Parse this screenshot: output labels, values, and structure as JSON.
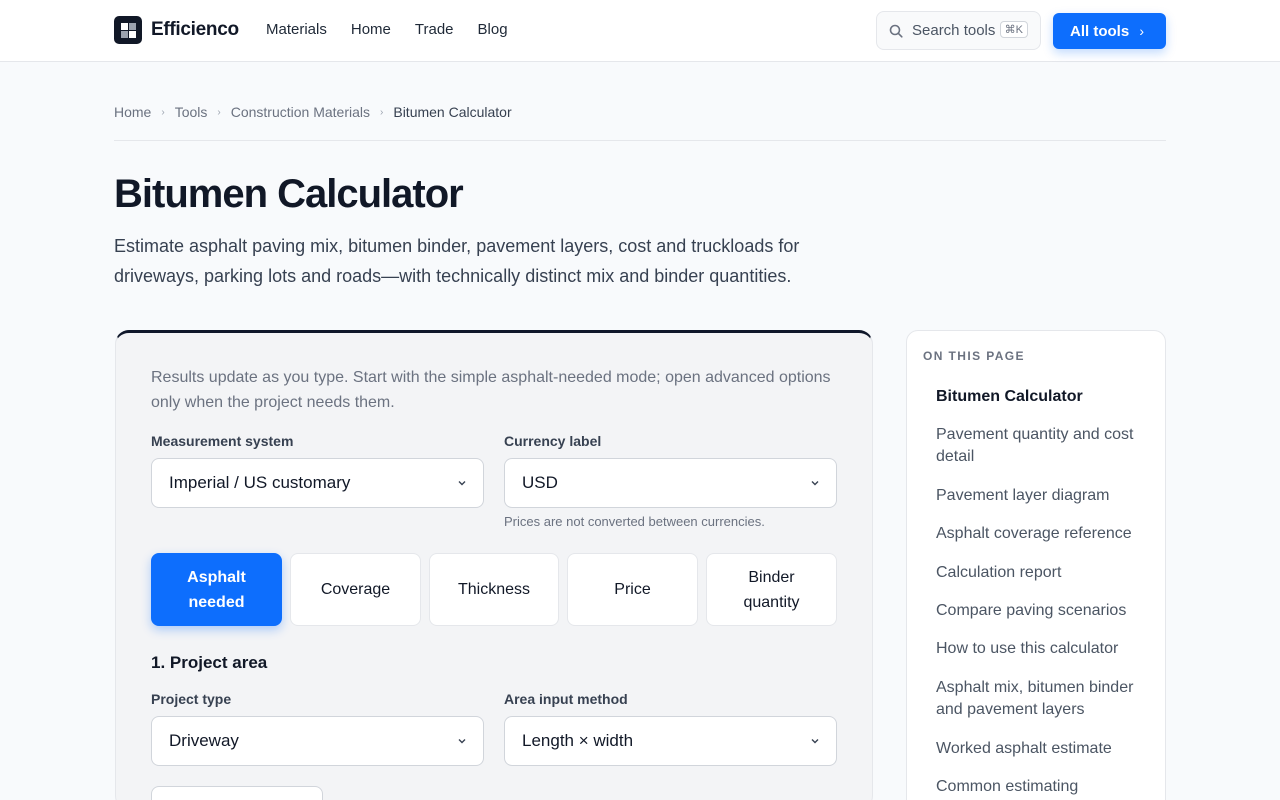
{
  "header": {
    "brand": "Efficienco",
    "nav": [
      "Materials",
      "Home",
      "Trade",
      "Blog"
    ],
    "search_label": "Search tools",
    "search_shortcut": "⌘K",
    "all_tools_label": "All tools",
    "accent": "#0d6efd"
  },
  "breadcrumb": [
    "Home",
    "Tools",
    "Construction Materials",
    "Bitumen Calculator"
  ],
  "page": {
    "title": "Bitumen Calculator",
    "lead": "Estimate asphalt paving mix, bitumen binder, pavement layers, cost and truckloads for driveways, parking lots and roads—with technically distinct mix and binder quantities."
  },
  "calculator": {
    "intro": "Results update as you type. Start with the simple asphalt-needed mode; open advanced options only when the project needs them.",
    "measurement": {
      "label": "Measurement system",
      "value": "Imperial / US customary"
    },
    "currency": {
      "label": "Currency label",
      "value": "USD",
      "help": "Prices are not converted between currencies."
    },
    "modes": [
      {
        "label": "Asphalt needed",
        "active": true
      },
      {
        "label": "Coverage",
        "active": false
      },
      {
        "label": "Thickness",
        "active": false
      },
      {
        "label": "Price",
        "active": false
      },
      {
        "label": "Binder quantity",
        "active": false
      }
    ],
    "section1": "1. Project area",
    "project_type": {
      "label": "Project type",
      "value": "Driveway"
    },
    "area_method": {
      "label": "Area input method",
      "value": "Length × width"
    }
  },
  "toc": {
    "heading": "ON THIS PAGE",
    "items": [
      "Bitumen Calculator",
      "Pavement quantity and cost detail",
      "Pavement layer diagram",
      "Asphalt coverage reference",
      "Calculation report",
      "Compare paving scenarios",
      "How to use this calculator",
      "Asphalt mix, bitumen binder and pavement layers",
      "Worked asphalt estimate",
      "Common estimating"
    ]
  }
}
